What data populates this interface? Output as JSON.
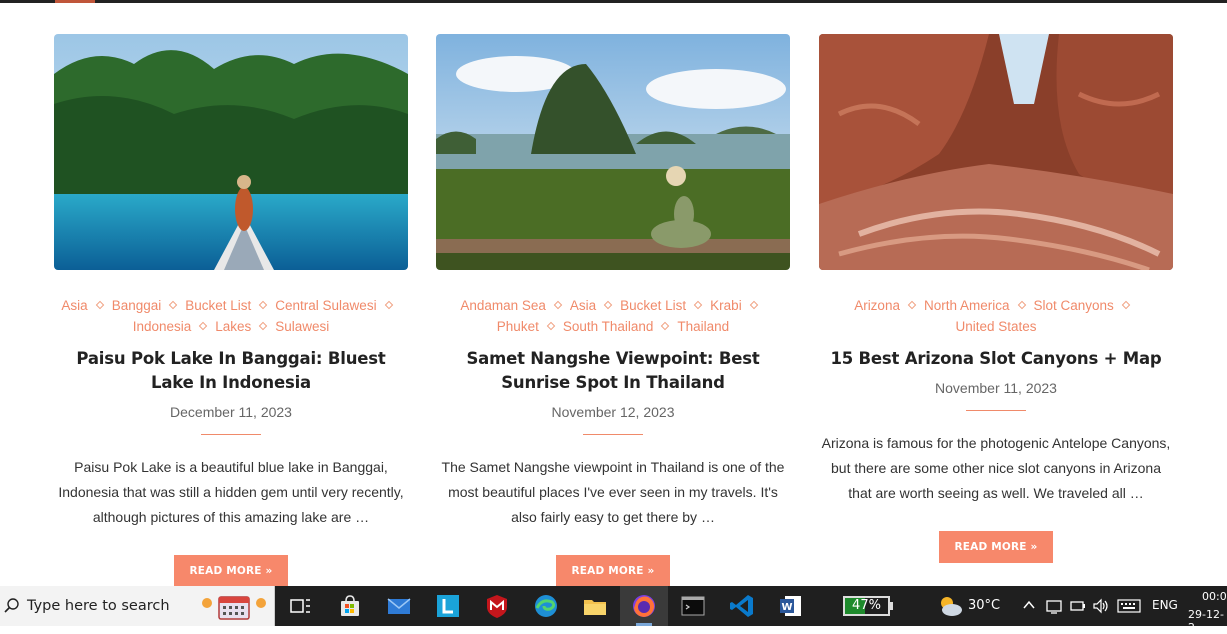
{
  "posts": [
    {
      "tags": [
        "Asia",
        "Banggai",
        "Bucket List",
        "Central Sulawesi",
        "Indonesia",
        "Lakes",
        "Sulawesi"
      ],
      "title": "Paisu Pok Lake In Banggai: Bluest Lake In Indonesia",
      "date": "December 11, 2023",
      "excerpt": "Paisu Pok Lake is a beautiful blue lake in Banggai, Indonesia that was still a hidden gem until very recently, although pictures of this amazing lake are …",
      "read_more": "READ MORE »"
    },
    {
      "tags": [
        "Andaman Sea",
        "Asia",
        "Bucket List",
        "Krabi",
        "Phuket",
        "South Thailand",
        "Thailand"
      ],
      "title": "Samet Nangshe Viewpoint: Best Sunrise Spot In Thailand",
      "date": "November 12, 2023",
      "excerpt": "The Samet Nangshe viewpoint in Thailand is one of the most beautiful places I've ever seen in my travels. It's also fairly easy to get there by …",
      "read_more": "READ MORE »"
    },
    {
      "tags": [
        "Arizona",
        "North America",
        "Slot Canyons",
        "United States"
      ],
      "title": "15 Best Arizona Slot Canyons + Map",
      "date": "November 11, 2023",
      "excerpt": "Arizona is famous for the photogenic Antelope Canyons, but there are some other nice slot canyons in Arizona that are worth seeing as well. We traveled all …",
      "read_more": "READ MORE »"
    }
  ],
  "taskbar": {
    "search_placeholder": "Type here to search",
    "apps": [
      "task-view",
      "microsoft-store",
      "mail",
      "l-app",
      "mcafee",
      "edge",
      "file-explorer",
      "firefox",
      "terminal",
      "vscode",
      "word"
    ],
    "battery": "47%",
    "battery_level": 0.47,
    "temperature": "30°C",
    "language": "ENG",
    "time": "00:0",
    "date": "29-12-2"
  },
  "colors": {
    "accent": "#f7886b",
    "tag": "#f08a6a",
    "taskbar": "#1f1f1f",
    "battery_fill": "#1e8a2c"
  }
}
